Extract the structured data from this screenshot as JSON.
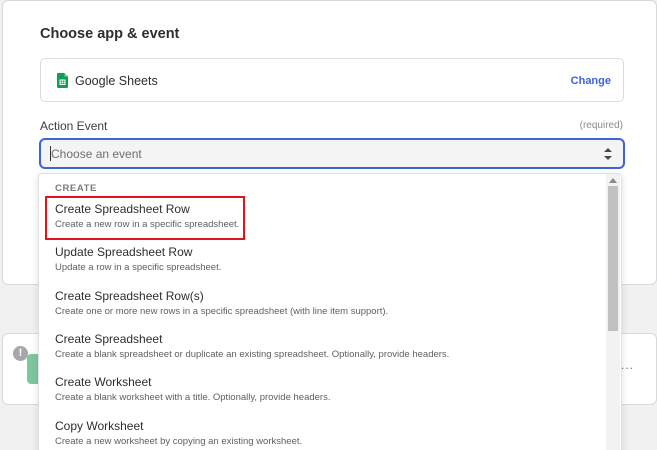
{
  "card": {
    "title": "Choose app & event",
    "app": {
      "name": "Google Sheets",
      "icon": "google-sheets-icon",
      "change_label": "Change"
    },
    "action_event": {
      "label": "Action Event",
      "required_label": "(required)",
      "placeholder": "Choose an event"
    }
  },
  "dropdown": {
    "group": "CREATE",
    "options": [
      {
        "title": "Create Spreadsheet Row",
        "desc": "Create a new row in a specific spreadsheet."
      },
      {
        "title": "Update Spreadsheet Row",
        "desc": "Update a row in a specific spreadsheet."
      },
      {
        "title": "Create Spreadsheet Row(s)",
        "desc": "Create one or more new rows in a specific spreadsheet (with line item support)."
      },
      {
        "title": "Create Spreadsheet",
        "desc": "Create a blank spreadsheet or duplicate an existing spreadsheet. Optionally, provide headers."
      },
      {
        "title": "Create Worksheet",
        "desc": "Create a blank worksheet with a title. Optionally, provide headers."
      },
      {
        "title": "Copy Worksheet",
        "desc": "Create a new worksheet by copying an existing worksheet."
      }
    ]
  },
  "background_step": {
    "warning_glyph": "!",
    "more_glyph": "..."
  },
  "colors": {
    "accent": "#3d63dd",
    "highlight": "#e0141c",
    "sheets_green": "#0f9d58"
  }
}
